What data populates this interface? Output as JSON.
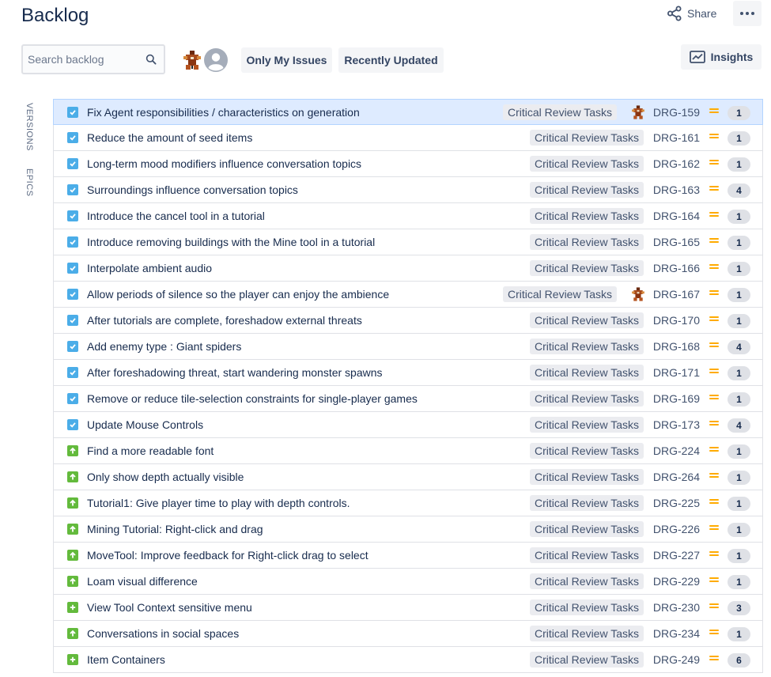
{
  "header": {
    "title": "Backlog",
    "share_label": "Share",
    "insights_label": "Insights"
  },
  "search": {
    "placeholder": "Search backlog"
  },
  "filters": {
    "only_my_issues": "Only My Issues",
    "recently_updated": "Recently Updated"
  },
  "sidebar": {
    "versions": "VERSIONS",
    "epics": "EPICS"
  },
  "colors": {
    "task_type": "#4bade8",
    "story_type": "#63ba3c",
    "priority_medium": "#ffab00",
    "selected_row": "#deebff"
  },
  "issues": [
    {
      "summary": "Fix Agent responsibilities / characteristics on generation",
      "epic": "Critical Review Tasks",
      "key": "DRG-159",
      "estimate": "1",
      "type": "task",
      "assignee": true,
      "selected": true
    },
    {
      "summary": "Reduce the amount of seed items",
      "epic": "Critical Review Tasks",
      "key": "DRG-161",
      "estimate": "1",
      "type": "task"
    },
    {
      "summary": "Long-term mood modifiers influence conversation topics",
      "epic": "Critical Review Tasks",
      "key": "DRG-162",
      "estimate": "1",
      "type": "task"
    },
    {
      "summary": "Surroundings influence conversation topics",
      "epic": "Critical Review Tasks",
      "key": "DRG-163",
      "estimate": "4",
      "type": "task"
    },
    {
      "summary": "Introduce the cancel tool in a tutorial",
      "epic": "Critical Review Tasks",
      "key": "DRG-164",
      "estimate": "1",
      "type": "task"
    },
    {
      "summary": "Introduce removing buildings with the Mine tool in a tutorial",
      "epic": "Critical Review Tasks",
      "key": "DRG-165",
      "estimate": "1",
      "type": "task"
    },
    {
      "summary": "Interpolate ambient audio",
      "epic": "Critical Review Tasks",
      "key": "DRG-166",
      "estimate": "1",
      "type": "task"
    },
    {
      "summary": "Allow periods of silence so the player can enjoy the ambience",
      "epic": "Critical Review Tasks",
      "key": "DRG-167",
      "estimate": "1",
      "type": "task",
      "assignee": true
    },
    {
      "summary": "After tutorials are complete, foreshadow external threats",
      "epic": "Critical Review Tasks",
      "key": "DRG-170",
      "estimate": "1",
      "type": "task"
    },
    {
      "summary": "Add enemy type : Giant spiders",
      "epic": "Critical Review Tasks",
      "key": "DRG-168",
      "estimate": "4",
      "type": "task"
    },
    {
      "summary": "After foreshadowing threat, start wandering monster spawns",
      "epic": "Critical Review Tasks",
      "key": "DRG-171",
      "estimate": "1",
      "type": "task"
    },
    {
      "summary": "Remove or reduce tile-selection constraints for single-player games",
      "epic": "Critical Review Tasks",
      "key": "DRG-169",
      "estimate": "1",
      "type": "task"
    },
    {
      "summary": "Update Mouse Controls",
      "epic": "Critical Review Tasks",
      "key": "DRG-173",
      "estimate": "4",
      "type": "task"
    },
    {
      "summary": "Find a more readable font",
      "epic": "Critical Review Tasks",
      "key": "DRG-224",
      "estimate": "1",
      "type": "improvement"
    },
    {
      "summary": "Only show depth actually visible",
      "epic": "Critical Review Tasks",
      "key": "DRG-264",
      "estimate": "1",
      "type": "improvement"
    },
    {
      "summary": "Tutorial1: Give player time to play with depth controls.",
      "epic": "Critical Review Tasks",
      "key": "DRG-225",
      "estimate": "1",
      "type": "improvement"
    },
    {
      "summary": "Mining Tutorial: Right-click and drag",
      "epic": "Critical Review Tasks",
      "key": "DRG-226",
      "estimate": "1",
      "type": "improvement"
    },
    {
      "summary": "MoveTool: Improve feedback for Right-click drag to select",
      "epic": "Critical Review Tasks",
      "key": "DRG-227",
      "estimate": "1",
      "type": "improvement"
    },
    {
      "summary": "Loam visual difference",
      "epic": "Critical Review Tasks",
      "key": "DRG-229",
      "estimate": "1",
      "type": "improvement"
    },
    {
      "summary": "View Tool Context sensitive menu",
      "epic": "Critical Review Tasks",
      "key": "DRG-230",
      "estimate": "3",
      "type": "new-feature"
    },
    {
      "summary": "Conversations in social spaces",
      "epic": "Critical Review Tasks",
      "key": "DRG-234",
      "estimate": "1",
      "type": "improvement"
    },
    {
      "summary": "Item Containers",
      "epic": "Critical Review Tasks",
      "key": "DRG-249",
      "estimate": "6",
      "type": "new-feature"
    }
  ]
}
